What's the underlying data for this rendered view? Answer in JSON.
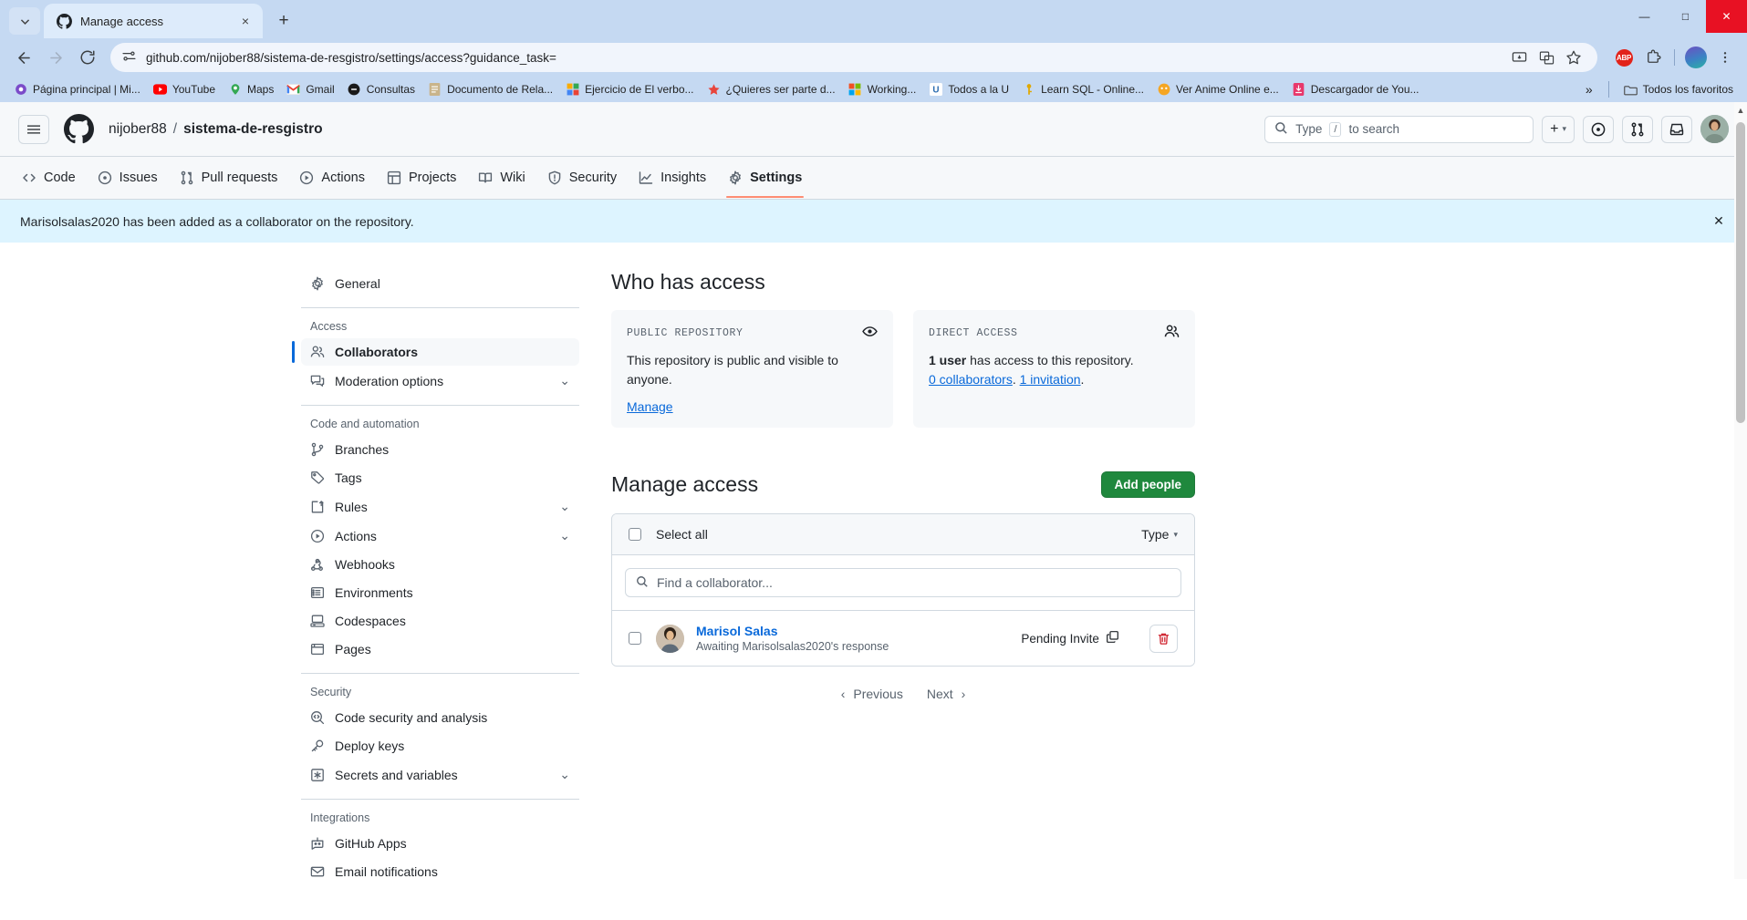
{
  "browser": {
    "tab": {
      "title": "Manage access",
      "favicon": "github-icon",
      "close": "×"
    },
    "new_tab": "+",
    "window_controls": {
      "minimize": "—",
      "maximize": "□",
      "close": "✕"
    },
    "url": "github.com/nijober88/sistema-de-resgistro/settings/access?guidance_task=",
    "nav": {
      "back": "←",
      "forward": "→",
      "reload": "⟳"
    },
    "bookmarks": [
      {
        "label": "Página principal | Mi...",
        "icon": "purple-globe-icon"
      },
      {
        "label": "YouTube",
        "icon": "youtube-icon"
      },
      {
        "label": "Maps",
        "icon": "maps-icon"
      },
      {
        "label": "Gmail",
        "icon": "gmail-icon"
      },
      {
        "label": "Consultas",
        "icon": "black-circle-icon"
      },
      {
        "label": "Documento de Rela...",
        "icon": "docs-icon"
      },
      {
        "label": "Ejercicio de El verbo...",
        "icon": "colorful-grid-icon"
      },
      {
        "label": "¿Quieres ser parte d...",
        "icon": "red-star-icon"
      },
      {
        "label": "Working...",
        "icon": "microsoft-icon"
      },
      {
        "label": "Todos a la U",
        "icon": "u-letter-icon"
      },
      {
        "label": "Learn SQL - Online...",
        "icon": "key-icon"
      },
      {
        "label": "Ver Anime Online e...",
        "icon": "orange-circle-icon"
      },
      {
        "label": "Descargador de You...",
        "icon": "download-pink-icon"
      }
    ],
    "bookmarks_overflow": "»",
    "all_favorites": "Todos los favoritos"
  },
  "gh_header": {
    "hamburger": "menu-icon",
    "logo": "github-logo",
    "owner": "nijober88",
    "separator": "/",
    "repo": "sistema-de-resgistro",
    "search_placeholder": "Type",
    "search_kbd": "/",
    "search_suffix": "to search",
    "plus_button": "+",
    "plus_caret": "▾"
  },
  "nav_tabs": [
    {
      "label": "Code",
      "icon": "code-icon",
      "active": false
    },
    {
      "label": "Issues",
      "icon": "issue-opened-icon",
      "active": false
    },
    {
      "label": "Pull requests",
      "icon": "git-pull-request-icon",
      "active": false
    },
    {
      "label": "Actions",
      "icon": "play-icon",
      "active": false
    },
    {
      "label": "Projects",
      "icon": "table-icon",
      "active": false
    },
    {
      "label": "Wiki",
      "icon": "book-icon",
      "active": false
    },
    {
      "label": "Security",
      "icon": "shield-icon",
      "active": false
    },
    {
      "label": "Insights",
      "icon": "graph-icon",
      "active": false
    },
    {
      "label": "Settings",
      "icon": "gear-icon",
      "active": true
    }
  ],
  "banner": {
    "message": "Marisolsalas2020 has been added as a collaborator on the repository.",
    "close": "✕"
  },
  "sidebar": {
    "general": {
      "label": "General",
      "icon": "gear-icon"
    },
    "groups": [
      {
        "heading": "Access",
        "items": [
          {
            "label": "Collaborators",
            "icon": "people-icon",
            "selected": true,
            "chevron": ""
          },
          {
            "label": "Moderation options",
            "icon": "comment-discussion-icon",
            "selected": false,
            "chevron": "⌄"
          }
        ]
      },
      {
        "heading": "Code and automation",
        "items": [
          {
            "label": "Branches",
            "icon": "git-branch-icon",
            "selected": false,
            "chevron": ""
          },
          {
            "label": "Tags",
            "icon": "tag-icon",
            "selected": false,
            "chevron": ""
          },
          {
            "label": "Rules",
            "icon": "rules-icon",
            "selected": false,
            "chevron": "⌄"
          },
          {
            "label": "Actions",
            "icon": "play-icon",
            "selected": false,
            "chevron": "⌄"
          },
          {
            "label": "Webhooks",
            "icon": "webhook-icon",
            "selected": false,
            "chevron": ""
          },
          {
            "label": "Environments",
            "icon": "server-icon",
            "selected": false,
            "chevron": ""
          },
          {
            "label": "Codespaces",
            "icon": "codespaces-icon",
            "selected": false,
            "chevron": ""
          },
          {
            "label": "Pages",
            "icon": "browser-icon",
            "selected": false,
            "chevron": ""
          }
        ]
      },
      {
        "heading": "Security",
        "items": [
          {
            "label": "Code security and analysis",
            "icon": "code-scan-icon",
            "selected": false,
            "chevron": ""
          },
          {
            "label": "Deploy keys",
            "icon": "key-icon",
            "selected": false,
            "chevron": ""
          },
          {
            "label": "Secrets and variables",
            "icon": "asterisk-icon",
            "selected": false,
            "chevron": "⌄"
          }
        ]
      },
      {
        "heading": "Integrations",
        "items": [
          {
            "label": "GitHub Apps",
            "icon": "app-icon",
            "selected": false,
            "chevron": ""
          },
          {
            "label": "Email notifications",
            "icon": "mail-icon",
            "selected": false,
            "chevron": ""
          }
        ]
      }
    ]
  },
  "main": {
    "who_has_access_title": "Who has access",
    "cards": [
      {
        "title": "PUBLIC REPOSITORY",
        "icon": "eye-icon",
        "body": "This repository is public and visible to anyone.",
        "link": "Manage"
      },
      {
        "title": "DIRECT ACCESS",
        "icon": "people-icon",
        "count": "1 user",
        "body_rest": " has access to this repository.",
        "link1": "0 collaborators",
        "dot1": ". ",
        "link2": "1 invitation",
        "dot2": "."
      }
    ],
    "manage_access_title": "Manage access",
    "add_people_button": "Add people",
    "select_all": "Select all",
    "type_dropdown": "Type",
    "type_caret": "▾",
    "find_placeholder": "Find a collaborator...",
    "collaborator": {
      "name": "Marisol Salas",
      "subtitle": "Awaiting Marisolsalas2020's response",
      "status": "Pending Invite",
      "status_icon": "copy-icon",
      "delete_icon": "trash-icon"
    },
    "pagination": {
      "prev_caret": "‹",
      "previous": "Previous",
      "next": "Next",
      "next_caret": "›"
    }
  },
  "colors": {
    "accent_blue": "#0969da",
    "green": "#1f883d",
    "banner_bg": "#ddf4ff",
    "active_tab_underline": "#fd8c73",
    "danger_red": "#cf222e"
  }
}
